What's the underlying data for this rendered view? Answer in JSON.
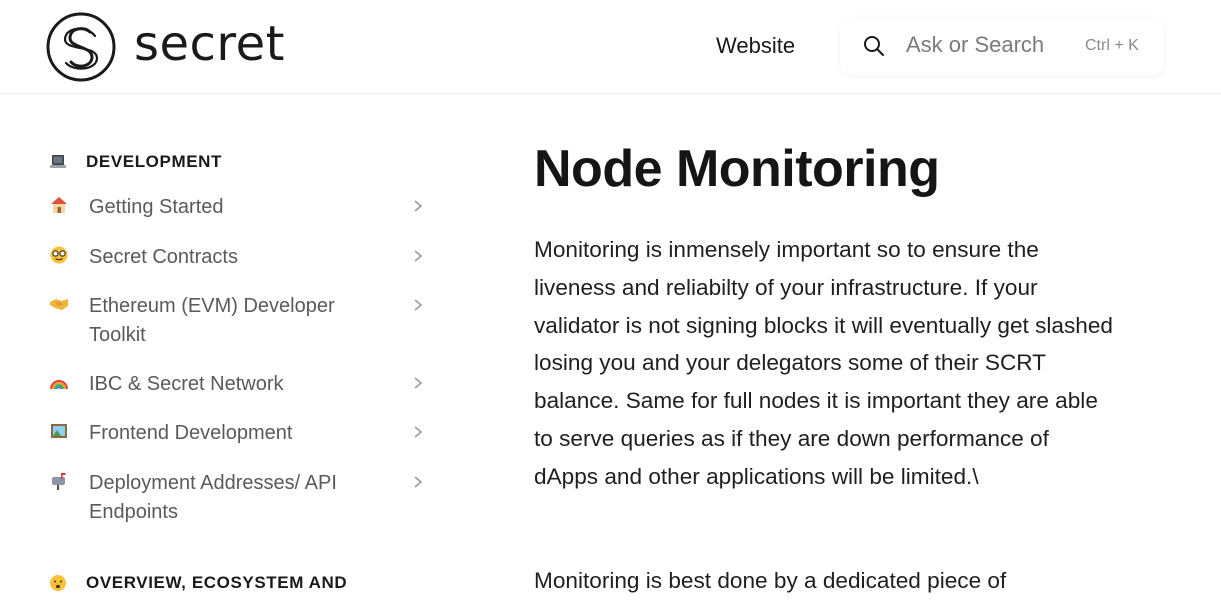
{
  "header": {
    "logo_text": "secret",
    "nav_link": "Website",
    "search": {
      "placeholder": "Ask or Search",
      "shortcut": "Ctrl + K"
    }
  },
  "sidebar": {
    "section1_title": "DEVELOPMENT",
    "items": [
      {
        "label": "Getting Started",
        "icon": "house-icon"
      },
      {
        "label": "Secret Contracts",
        "icon": "nerd-face-icon"
      },
      {
        "label": "Ethereum (EVM) Developer Toolkit",
        "icon": "handshake-icon"
      },
      {
        "label": "IBC & Secret Network",
        "icon": "rainbow-icon"
      },
      {
        "label": "Frontend Development",
        "icon": "picture-icon"
      },
      {
        "label": "Deployment Addresses/ API Endpoints",
        "icon": "mailbox-icon"
      }
    ],
    "section2_title": "OVERVIEW, ECOSYSTEM AND"
  },
  "main": {
    "title": "Node Monitoring",
    "paragraph1": "Monitoring is inmensely important so to ensure the liveness and reliabilty of your infrastructure. If your validator is not signing blocks it will eventually get slashed losing you and your delegators some of their SCRT balance. Same for full nodes it is important they are able to serve queries as if they are down performance of dApps and other applications will be limited.\\",
    "paragraph2": "Monitoring is best done by a dedicated piece of"
  }
}
